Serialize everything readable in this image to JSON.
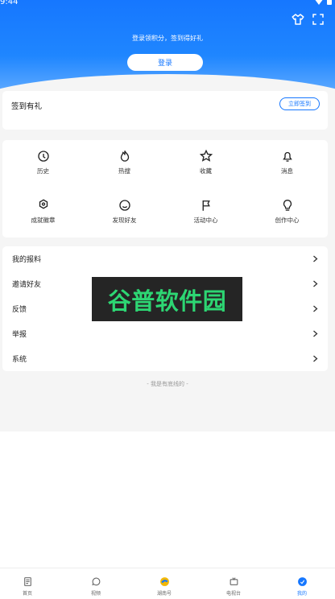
{
  "status": {
    "time": "9:44"
  },
  "header": {
    "tip": "登录领积分，签到得好礼",
    "login_label": "登录"
  },
  "top_actions": [
    {
      "icon": "shirt-icon"
    },
    {
      "icon": "scan-icon"
    }
  ],
  "sign": {
    "title": "签到有礼",
    "button": "立即签到"
  },
  "grid": [
    {
      "label": "历史",
      "icon": "history-icon"
    },
    {
      "label": "热搜",
      "icon": "flame-icon"
    },
    {
      "label": "收藏",
      "icon": "star-icon"
    },
    {
      "label": "消息",
      "icon": "bell-icon"
    },
    {
      "label": "成就徽章",
      "icon": "badge-icon"
    },
    {
      "label": "发现好友",
      "icon": "smile-icon"
    },
    {
      "label": "活动中心",
      "icon": "flag-icon"
    },
    {
      "label": "创作中心",
      "icon": "bulb-icon"
    }
  ],
  "menu": [
    {
      "label": "我的报料"
    },
    {
      "label": "邀请好友"
    },
    {
      "label": "反馈"
    },
    {
      "label": "举报"
    },
    {
      "label": "系统"
    }
  ],
  "footer_note": "- 我是有底线的 -",
  "watermark": "谷普软件园",
  "tabs": [
    {
      "label": "首页",
      "icon": "home-icon"
    },
    {
      "label": "视频",
      "icon": "chat-icon"
    },
    {
      "label": "湖南号",
      "icon": "hunan-icon"
    },
    {
      "label": "电视台",
      "icon": "tv-icon"
    },
    {
      "label": "我的",
      "icon": "profile-icon"
    }
  ],
  "colors": {
    "primary": "#1677ff",
    "background": "#f5f5f5",
    "watermark_text": "#2dd673"
  }
}
